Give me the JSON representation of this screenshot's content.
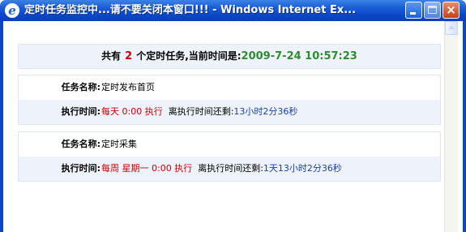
{
  "window": {
    "title": "定时任务监控中...请不要关闭本窗口!!! - Windows Internet Ex...",
    "app_icon": "e",
    "controls": {
      "close_glyph": "×"
    }
  },
  "summary": {
    "prefix": "共有",
    "task_count": "2",
    "middle": "个定时任务,当前时间是:",
    "current_time": "2009-7-24 10:57:23"
  },
  "tasks": [
    {
      "name_label": "任务名称:",
      "name": "定时发布首页",
      "time_label": "执行时间:",
      "schedule": "每天 0:00 执行",
      "remaining_label": "离执行时间还剩:",
      "remaining": "13小时2分36秒"
    },
    {
      "name_label": "任务名称:",
      "name": "定时采集",
      "time_label": "执行时间:",
      "schedule": "每周 星期一 0:00 执行",
      "remaining_label": "离执行时间还剩:",
      "remaining": "1天13小时2分36秒"
    }
  ],
  "colors": {
    "title_bar": "#0b48c8",
    "count": "#cc0000",
    "time": "#2e8b2e",
    "remaining": "#1a3fa8"
  }
}
